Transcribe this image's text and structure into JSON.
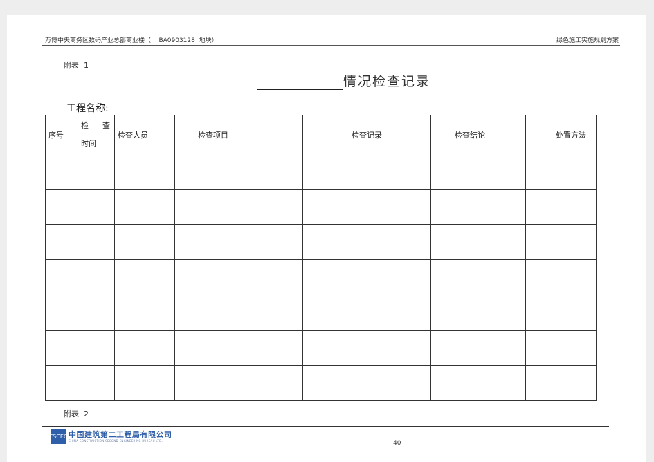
{
  "header": {
    "left": "万博中央商务区数码产业总部商业楼（    BA0903128  地块）",
    "right": "绿色施工实施规划方案"
  },
  "appendix1": "附表  1",
  "title": "情况检查记录",
  "project_name_label": "工程名称:",
  "table": {
    "columns": [
      "序号",
      "检查人员",
      "检查项目",
      "检查记录",
      "检查结论",
      "处置方法"
    ],
    "time_col": {
      "char1": "检",
      "char2": "查",
      "line2": "时间"
    },
    "empty_rows": 7
  },
  "appendix2": "附表  2",
  "footer": {
    "logo_mark": "CSCEC",
    "logo_cn": "中国建筑第二工程局有限公司",
    "logo_en": "CHINA CONSTRUCTION SECOND ENGINEERING BUREAU LTD.",
    "page_number": "40"
  }
}
